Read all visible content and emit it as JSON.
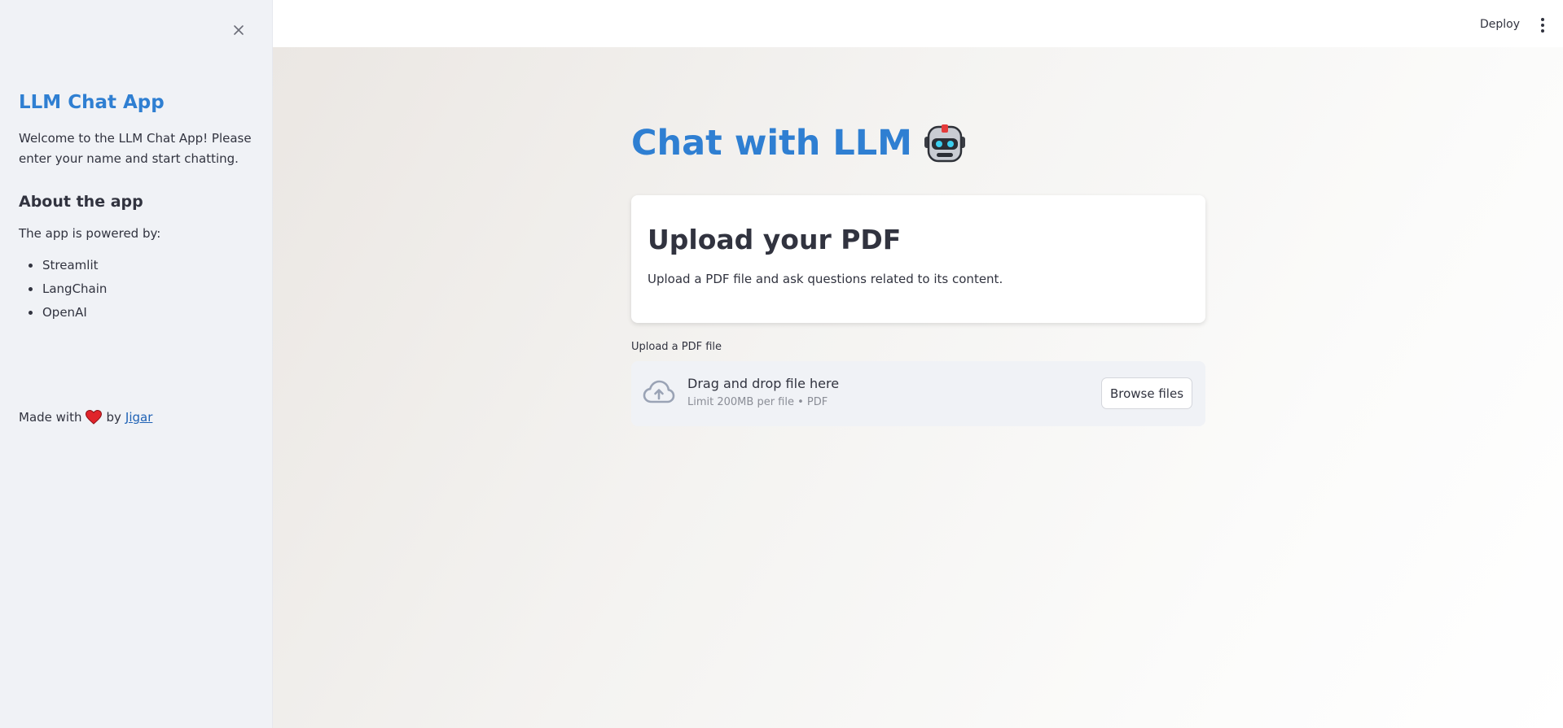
{
  "sidebar": {
    "title": "LLM Chat App",
    "welcome": "Welcome to the LLM Chat App! Please enter your name and start chatting.",
    "about_heading": "About the app",
    "powered_by": "The app is powered by:",
    "powered_items": [
      "Streamlit",
      "LangChain",
      "OpenAI"
    ],
    "made_with_prefix": "Made with",
    "made_with_by": "by",
    "author_link": "Jigar",
    "close_icon": "close-icon",
    "heart_icon": "heart-icon"
  },
  "header": {
    "deploy_label": "Deploy",
    "menu_icon": "kebab-menu-icon"
  },
  "main": {
    "title": "Chat with LLM",
    "title_icon": "robot-icon",
    "card_heading": "Upload your PDF",
    "card_text": "Upload a PDF file and ask questions related to its content.",
    "upload_label": "Upload a PDF file",
    "drop_title": "Drag and drop file here",
    "drop_limit": "Limit 200MB per file • PDF",
    "browse_label": "Browse files",
    "upload_icon": "cloud-upload-icon"
  },
  "colors": {
    "accent": "#2f7fd2",
    "sidebar_bg": "#f0f2f6",
    "text": "#31333f",
    "link": "#1f62b5",
    "heart": "#e0242b"
  }
}
